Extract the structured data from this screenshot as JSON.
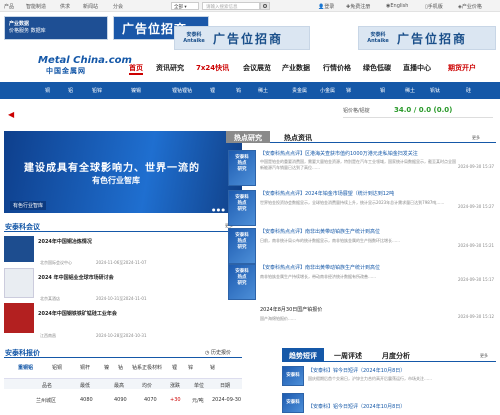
{
  "topbar": {
    "items": [
      "产品",
      "智能制造",
      "供求",
      "新闻站",
      "分会"
    ],
    "search_scope": "全部",
    "search_placeholder": "请输入搜索信息",
    "login": "登录",
    "register": "免费注册",
    "lang": "English",
    "mobile": "手机版",
    "industry": "产业价格"
  },
  "ads": {
    "brand1": "产业数据",
    "brand1_sub": "价格服务  数据库",
    "ad1_text": "广告位招商",
    "brand2": "安泰科 Antaike",
    "ad2_text": "广告位招商",
    "brand3": "安泰科 Antaike",
    "ad3_text": "广告位招商"
  },
  "logo": {
    "main": "Metal China.com",
    "cn": "中国金属网"
  },
  "nav": [
    "首页",
    "资讯研究",
    "7x24快讯",
    "会议展览",
    "产业数据",
    "行情价格",
    "绿色低碳",
    "直播中心",
    "期货开户"
  ],
  "subnav": [
    "铜",
    "铝",
    "铅锌",
    "镍锡",
    "锂钴锂钴",
    "锂",
    "钨",
    "稀土",
    "贵金属",
    "小金属",
    "锑",
    "钼",
    "稀土",
    "钒钛",
    "硅"
  ],
  "quote": {
    "label": "铝价格/铝锭",
    "value": "34.0 / 0.0 (0.0)"
  },
  "banner": {
    "line1": "建设成具有全球影响力、世界一流的",
    "line2": "有色行业智库",
    "badge": "有色行业智库"
  },
  "meeting": {
    "title": "安泰科会议",
    "more": "更多",
    "items": [
      {
        "title": "2024年中国铜冶炼情况",
        "tag": "北京国际会议中心",
        "date": "2024-11-06至2024-11-07"
      },
      {
        "title": "2024 年中国铝业全球市场研讨会",
        "tag": "北京某酒店",
        "date": "2024-10-31至2024-11-01"
      },
      {
        "title": "2024年中国钢铁铁矿锰硅工业年会",
        "tag": "江西南昌",
        "date": "2024-10-28至2024-10-31"
      }
    ]
  },
  "report": {
    "title": "安泰科报价",
    "history": "历史报价",
    "tabs": [
      "重铜铝",
      "铝铜",
      "铜杆",
      "镍",
      "钴",
      "钴系正极材料",
      "锂",
      "锌",
      "铋"
    ],
    "headers": [
      "品名",
      "最低",
      "最高",
      "均价",
      "涨跌",
      "单位",
      "日期"
    ],
    "row": [
      "兰州城区",
      "4080",
      "4090",
      "4070",
      "+30",
      "元/吨",
      "2024-09-30"
    ]
  },
  "news": {
    "tab1": "热点研究",
    "tab2": "热点资讯",
    "more": "更多",
    "items": [
      {
        "title": "【安泰科热点点评】区港海关查获市值约1000万港元走私铂金扫发关注",
        "desc": "中国是铂金的重要消费国，需要大量铂金资源，特别是在汽车工业领域，国家统计局数据显示，截至某时点全国新能源汽车销量已达到了高位……",
        "date": "2024-09-30 15:37"
      },
      {
        "title": "【安泰科热点点评】2024年铂金市场展望（统计到达到12吨",
        "desc": "世界铂金投资协会数据显示，全球铂金消费量持续上升，统计显示2023年总计需求量已达到7987吨……",
        "date": "2024-09-30 15:27"
      },
      {
        "title": "【安泰科热点点评】南非出黄带动铂族生产统计到高位",
        "desc": "日前，南非统计局公布的统计数据显示，南非铂族金属的生产指数环比增长……",
        "date": "2024-09-30 15:21"
      },
      {
        "title": "【安泰科热点点评】南非出黄带动铂族生产统计到高位",
        "desc": "南非铂族金属生产持续增长，带动南非经济统计数据有所改善……",
        "date": "2024-09-30 15:17"
      },
      {
        "title": "2024年8月30日国产铂报价",
        "desc": "国产海绵铂报价……",
        "date": "2024-09-30 15:12"
      }
    ]
  },
  "trends": {
    "tab1": "趋势短评",
    "tab2": "一周评述",
    "tab3": "月度分析",
    "more": "更多",
    "items": [
      {
        "title": "【安泰科】锌今日短评（2024年10月8日）",
        "desc": "国庆假期后首个交易日，沪锌主力合约高开后震荡运行，市场关注……"
      },
      {
        "title": "【安泰科】铝今日短评（2024年10月8日）",
        "desc": ""
      }
    ]
  }
}
